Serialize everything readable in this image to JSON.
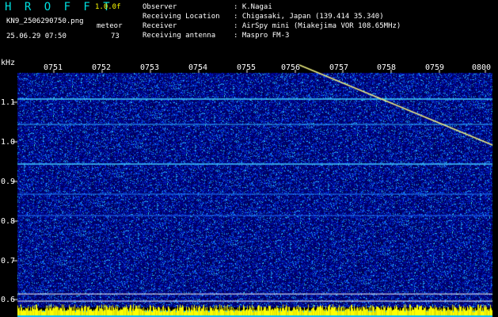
{
  "header": {
    "app_title": "H R O F F T",
    "version": "1.0.0f",
    "filename": "KN9_2506290750.png",
    "mode": "meteor",
    "timestamp": "25.06.29 07:50",
    "count": "73",
    "info_rows": [
      {
        "label": "Observer",
        "value": ": K.Nagai"
      },
      {
        "label": "Receiving Location",
        "value": ": Chigasaki, Japan (139.414 35.340)"
      },
      {
        "label": "Receiver",
        "value": ": AirSpy mini (Miakejima VOR 108.65MHz)"
      },
      {
        "label": "Receiving antenna",
        "value": ": Maspro FM-3"
      }
    ]
  },
  "spectrogram": {
    "y_unit": "kHz",
    "time_ticks": [
      "0751",
      "0752",
      "0753",
      "0754",
      "0755",
      "0756",
      "0757",
      "0758",
      "0759",
      "0800"
    ],
    "freq_ticks": [
      "1.1",
      "1.0",
      "0.9",
      "0.8",
      "0.7",
      "0.6"
    ],
    "colors": {
      "noise": "#1020a0",
      "line": "#40c8ff",
      "trace": "#ffff80",
      "bar": "#ffff00",
      "bar_low": "#00c0ff"
    }
  }
}
